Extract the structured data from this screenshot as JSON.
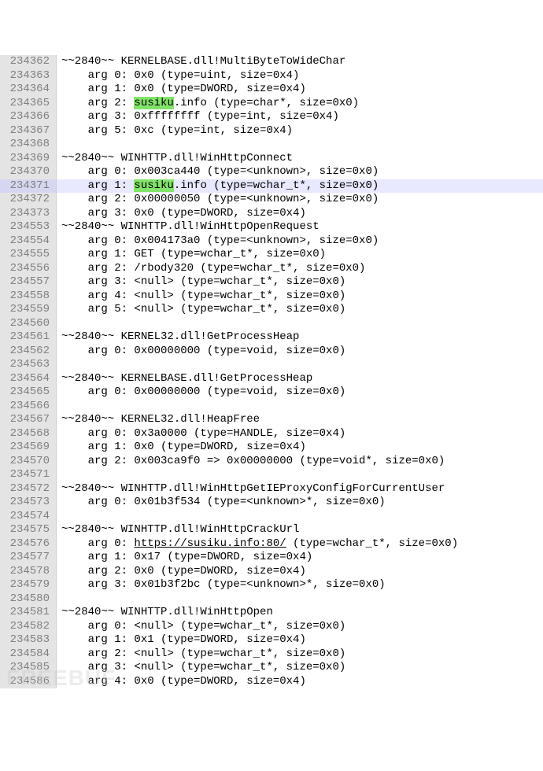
{
  "highlight_word": "susiku",
  "watermark": "FREEBUF",
  "rows": [
    {
      "ln": "234362",
      "indent": 0,
      "text": "~~2840~~ KERNELBASE.dll!MultiByteToWideChar"
    },
    {
      "ln": "234363",
      "indent": 1,
      "text": "arg 0: 0x0 (type=uint, size=0x4)"
    },
    {
      "ln": "234364",
      "indent": 1,
      "text": "arg 1: 0x0 (type=DWORD, size=0x4)"
    },
    {
      "ln": "234365",
      "indent": 1,
      "text": "arg 2: susiku.info (type=char*, size=0x0)",
      "hl": true
    },
    {
      "ln": "234366",
      "indent": 1,
      "text": "arg 3: 0xffffffff (type=int, size=0x4)"
    },
    {
      "ln": "234367",
      "indent": 1,
      "text": "arg 5: 0xc (type=int, size=0x4)"
    },
    {
      "ln": "234368",
      "indent": 0,
      "text": ""
    },
    {
      "ln": "234369",
      "indent": 0,
      "text": "~~2840~~ WINHTTP.dll!WinHttpConnect"
    },
    {
      "ln": "234370",
      "indent": 1,
      "text": "arg 0: 0x003ca440 (type=<unknown>, size=0x0)"
    },
    {
      "ln": "234371",
      "indent": 1,
      "text": "arg 1: susiku.info (type=wchar_t*, size=0x0)",
      "hl": true,
      "hl_line": true
    },
    {
      "ln": "234372",
      "indent": 1,
      "text": "arg 2: 0x00000050 (type=<unknown>, size=0x0)"
    },
    {
      "ln": "234373",
      "indent": 1,
      "text": "arg 3: 0x0 (type=DWORD, size=0x4)"
    },
    {
      "ln": "234553",
      "indent": 0,
      "text": "~~2840~~ WINHTTP.dll!WinHttpOpenRequest"
    },
    {
      "ln": "234554",
      "indent": 1,
      "text": "arg 0: 0x004173a0 (type=<unknown>, size=0x0)"
    },
    {
      "ln": "234555",
      "indent": 1,
      "text": "arg 1: GET (type=wchar_t*, size=0x0)"
    },
    {
      "ln": "234556",
      "indent": 1,
      "text": "arg 2: /rbody320 (type=wchar_t*, size=0x0)"
    },
    {
      "ln": "234557",
      "indent": 1,
      "text": "arg 3: <null> (type=wchar_t*, size=0x0)"
    },
    {
      "ln": "234558",
      "indent": 1,
      "text": "arg 4: <null> (type=wchar_t*, size=0x0)"
    },
    {
      "ln": "234559",
      "indent": 1,
      "text": "arg 5: <null> (type=wchar_t*, size=0x0)"
    },
    {
      "ln": "234560",
      "indent": 0,
      "text": ""
    },
    {
      "ln": "234561",
      "indent": 0,
      "text": "~~2840~~ KERNEL32.dll!GetProcessHeap"
    },
    {
      "ln": "234562",
      "indent": 1,
      "text": "arg 0: 0x00000000 (type=void, size=0x0)"
    },
    {
      "ln": "234563",
      "indent": 0,
      "text": ""
    },
    {
      "ln": "234564",
      "indent": 0,
      "text": "~~2840~~ KERNELBASE.dll!GetProcessHeap"
    },
    {
      "ln": "234565",
      "indent": 1,
      "text": "arg 0: 0x00000000 (type=void, size=0x0)"
    },
    {
      "ln": "234566",
      "indent": 0,
      "text": ""
    },
    {
      "ln": "234567",
      "indent": 0,
      "text": "~~2840~~ KERNEL32.dll!HeapFree"
    },
    {
      "ln": "234568",
      "indent": 1,
      "text": "arg 0: 0x3a0000 (type=HANDLE, size=0x4)"
    },
    {
      "ln": "234569",
      "indent": 1,
      "text": "arg 1: 0x0 (type=DWORD, size=0x4)"
    },
    {
      "ln": "234570",
      "indent": 1,
      "text": "arg 2: 0x003ca9f0 => 0x00000000 (type=void*, size=0x0)"
    },
    {
      "ln": "234571",
      "indent": 0,
      "text": ""
    },
    {
      "ln": "234572",
      "indent": 0,
      "text": "~~2840~~ WINHTTP.dll!WinHttpGetIEProxyConfigForCurrentUser"
    },
    {
      "ln": "234573",
      "indent": 1,
      "text": "arg 0: 0x01b3f534 (type=<unknown>*, size=0x0)"
    },
    {
      "ln": "234574",
      "indent": 0,
      "text": ""
    },
    {
      "ln": "234575",
      "indent": 0,
      "text": "~~2840~~ WINHTTP.dll!WinHttpCrackUrl"
    },
    {
      "ln": "234576",
      "indent": 1,
      "text": "arg 0: https://susiku.info:80/ (type=wchar_t*, size=0x0)",
      "url": "https://susiku.info:80/"
    },
    {
      "ln": "234577",
      "indent": 1,
      "text": "arg 1: 0x17 (type=DWORD, size=0x4)"
    },
    {
      "ln": "234578",
      "indent": 1,
      "text": "arg 2: 0x0 (type=DWORD, size=0x4)"
    },
    {
      "ln": "234579",
      "indent": 1,
      "text": "arg 3: 0x01b3f2bc (type=<unknown>*, size=0x0)"
    },
    {
      "ln": "234580",
      "indent": 0,
      "text": ""
    },
    {
      "ln": "234581",
      "indent": 0,
      "text": "~~2840~~ WINHTTP.dll!WinHttpOpen"
    },
    {
      "ln": "234582",
      "indent": 1,
      "text": "arg 0: <null> (type=wchar_t*, size=0x0)"
    },
    {
      "ln": "234583",
      "indent": 1,
      "text": "arg 1: 0x1 (type=DWORD, size=0x4)"
    },
    {
      "ln": "234584",
      "indent": 1,
      "text": "arg 2: <null> (type=wchar_t*, size=0x0)"
    },
    {
      "ln": "234585",
      "indent": 1,
      "text": "arg 3: <null> (type=wchar_t*, size=0x0)"
    },
    {
      "ln": "234586",
      "indent": 1,
      "text": "arg 4: 0x0 (type=DWORD, size=0x4)"
    }
  ]
}
